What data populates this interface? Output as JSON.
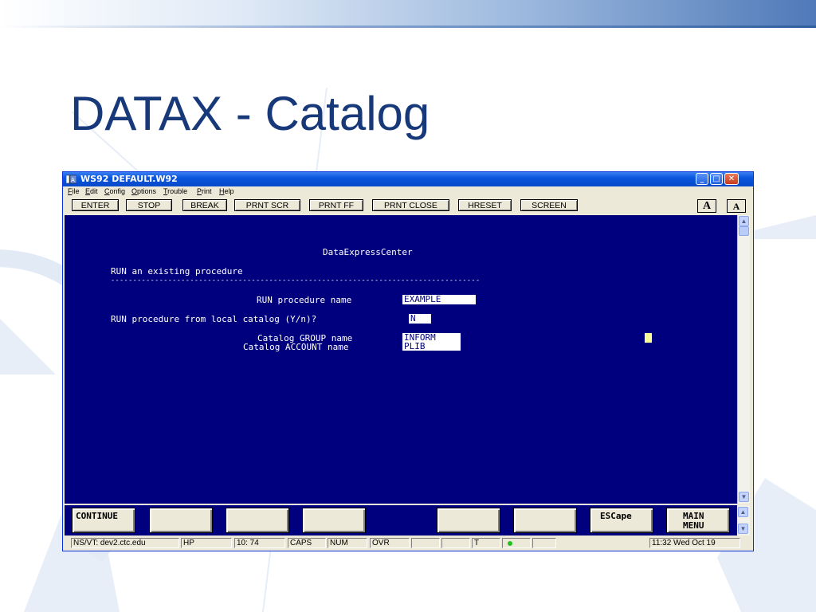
{
  "slide": {
    "title": "DATAX - Catalog"
  },
  "window": {
    "title": "WS92 DEFAULT.W92",
    "menu": [
      "File",
      "Edit",
      "Config",
      "Options",
      "Trouble",
      "Print",
      "Help"
    ],
    "toolbar_buttons": [
      "ENTER",
      "STOP",
      "BREAK",
      "PRNT SCR",
      "PRNT FF",
      "PRNT CLOSE",
      "HRESET",
      "SCREEN"
    ],
    "font_buttons": [
      "A",
      "A"
    ]
  },
  "terminal": {
    "header": "DataExpressCenter",
    "subtitle": "RUN an existing procedure",
    "divider": "------------------------------------------------------------------------------------",
    "proc_name_label": "RUN procedure name",
    "proc_name_value": "EXAMPLE",
    "local_catalog_label": "RUN procedure from local catalog (Y/n)?",
    "local_catalog_value": "N",
    "group_label": "Catalog GROUP name",
    "group_value": "INFORM",
    "account_label": "Catalog ACCOUNT name",
    "account_value": "PLIB"
  },
  "function_keys": {
    "f1": "CONTINUE",
    "f2": "",
    "f3": "",
    "f4": "",
    "f5": "",
    "f6": "",
    "f7": "ESCape",
    "f8": "MAIN\nMENU"
  },
  "status_bar": {
    "connection": "NS/VT: dev2.ctc.edu",
    "terminal_type": "HP",
    "cursor_pos": "10: 74",
    "caps": "CAPS",
    "num": "NUM",
    "ovr": "OVR",
    "t_flag": "T",
    "clock": "11:32  Wed Oct 19"
  },
  "colors": {
    "terminal_bg": "#00007f",
    "title_text": "#17397a",
    "online_led": "#1ec31e"
  }
}
